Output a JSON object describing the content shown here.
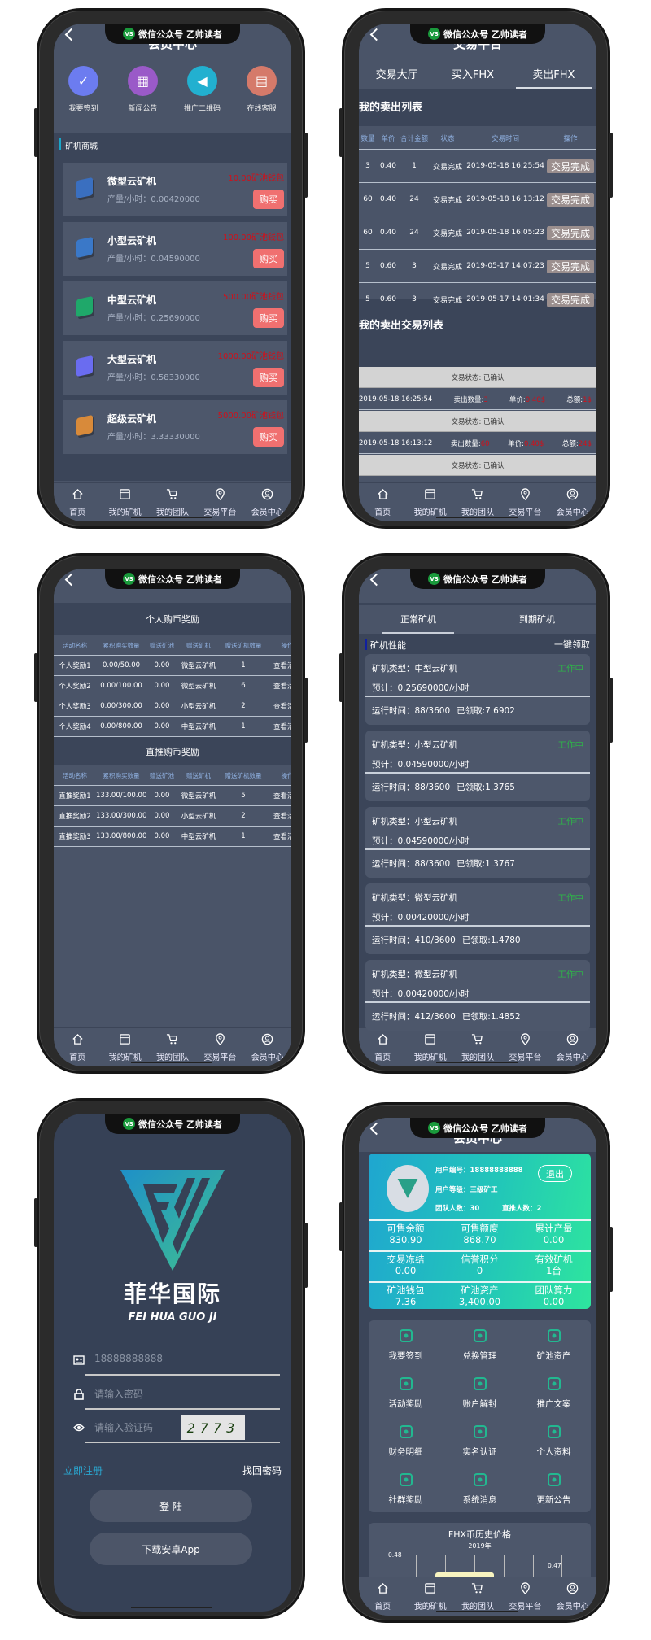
{
  "watermark": {
    "logo": "VS",
    "text": "微信公众号  乙帅读者"
  },
  "nav": [
    {
      "label": "首页",
      "icon": "home-icon"
    },
    {
      "label": "我的矿机",
      "icon": "store-icon"
    },
    {
      "label": "我的团队",
      "icon": "cart-icon"
    },
    {
      "label": "交易平台",
      "icon": "location-pin-icon"
    },
    {
      "label": "会员中心",
      "icon": "user-circle-icon"
    }
  ],
  "phone1": {
    "title": "会员中心",
    "quick": [
      {
        "label": "我要签到",
        "icon": "calendar-check-icon",
        "color": "#6c7cf0"
      },
      {
        "label": "新闻公告",
        "icon": "qr-code-icon",
        "color": "#9a5ac8"
      },
      {
        "label": "推广二维码",
        "icon": "speaker-icon",
        "color": "#22b0d0"
      },
      {
        "label": "在线客服",
        "icon": "document-icon",
        "color": "#d57a6a"
      }
    ],
    "section": "矿机商城",
    "buy_label": "购买",
    "rate_label": "产量/小时：",
    "products": [
      {
        "name": "微型云矿机",
        "rate": "0.00420000",
        "price": "10.00矿池钱包",
        "color": "#3a6fc0"
      },
      {
        "name": "小型云矿机",
        "rate": "0.04590000",
        "price": "100.00矿池钱包",
        "color": "#3a78c8"
      },
      {
        "name": "中型云矿机",
        "rate": "0.25690000",
        "price": "500.00矿池钱包",
        "color": "#1fa86a"
      },
      {
        "name": "大型云矿机",
        "rate": "0.58330000",
        "price": "1000.00矿池钱包",
        "color": "#6a6cf0"
      },
      {
        "name": "超级云矿机",
        "rate": "3.33330000",
        "price": "5000.00矿池钱包",
        "color": "#d88a3a"
      }
    ]
  },
  "phone2": {
    "title": "交易平台",
    "tabs": [
      "交易大厅",
      "买入FHX",
      "卖出FHX"
    ],
    "active_tab": 2,
    "sell_list_title": "我的卖出列表",
    "columns": [
      "数量",
      "单价",
      "合计金额",
      "状态",
      "交易时间",
      "操作"
    ],
    "rows": [
      [
        "3",
        "0.40",
        "1",
        "交易完成",
        "2019-05-18 16:25:54",
        "交易完成"
      ],
      [
        "60",
        "0.40",
        "24",
        "交易完成",
        "2019-05-18 16:13:12",
        "交易完成"
      ],
      [
        "60",
        "0.40",
        "24",
        "交易完成",
        "2019-05-18 16:05:23",
        "交易完成"
      ],
      [
        "5",
        "0.60",
        "3",
        "交易完成",
        "2019-05-17 14:07:23",
        "交易完成"
      ],
      [
        "5",
        "0.60",
        "3",
        "交易完成",
        "2019-05-17 14:01:34",
        "交易完成"
      ]
    ],
    "trade_list_title": "我的卖出交易列表",
    "qty_label": "卖出数量:",
    "price_label": "单价:",
    "total_label": "总额:",
    "trades": [
      {
        "status": "交易状态: 已确认",
        "time": "2019-05-18 16:25:54",
        "qty": "3",
        "price": "0.40$",
        "total": "1$"
      },
      {
        "status": "交易状态: 已确认",
        "time": "2019-05-18 16:13:12",
        "qty": "60",
        "price": "0.40$",
        "total": "24$"
      },
      {
        "status": "交易状态: 已确认"
      }
    ]
  },
  "phone3": {
    "sections": [
      {
        "title": "个人购币奖励",
        "columns": [
          "活动名称",
          "累积购买数量",
          "赠送矿池",
          "赠送矿机",
          "赠送矿机数量",
          "操作"
        ],
        "rows": [
          [
            "个人奖励1",
            "0.00/50.00",
            "0.00",
            "微型云矿机",
            "1",
            "查看活动"
          ],
          [
            "个人奖励2",
            "0.00/100.00",
            "0.00",
            "微型云矿机",
            "6",
            "查看活动"
          ],
          [
            "个人奖励3",
            "0.00/300.00",
            "0.00",
            "小型云矿机",
            "2",
            "查看活动"
          ],
          [
            "个人奖励4",
            "0.00/800.00",
            "0.00",
            "中型云矿机",
            "1",
            "查看活动"
          ]
        ]
      },
      {
        "title": "直推购币奖励",
        "columns": [
          "活动名称",
          "累积购买数量",
          "赠送矿池",
          "赠送矿机",
          "赠送矿机数量",
          "操作"
        ],
        "rows": [
          [
            "直推奖励1",
            "133.00/100.00",
            "0.00",
            "微型云矿机",
            "5",
            "查看活动"
          ],
          [
            "直推奖励2",
            "133.00/300.00",
            "0.00",
            "小型云矿机",
            "2",
            "查看活动"
          ],
          [
            "直推奖励3",
            "133.00/800.00",
            "0.00",
            "中型云矿机",
            "1",
            "查看活动"
          ]
        ]
      }
    ]
  },
  "phone4": {
    "tabs": [
      "正常矿机",
      "到期矿机"
    ],
    "active_tab": 0,
    "section": "矿机性能",
    "claim_all": "一键领取",
    "machines": [
      {
        "type": "矿机类型：中型云矿机",
        "status": "工作中",
        "estimate": "预计：0.25690000/小时",
        "runtime": "运行时间：88/3600",
        "claimed": "已领取:7.6902"
      },
      {
        "type": "矿机类型：小型云矿机",
        "status": "工作中",
        "estimate": "预计：0.04590000/小时",
        "runtime": "运行时间：88/3600",
        "claimed": "已领取:1.3765"
      },
      {
        "type": "矿机类型：小型云矿机",
        "status": "工作中",
        "estimate": "预计：0.04590000/小时",
        "runtime": "运行时间：88/3600",
        "claimed": "已领取:1.3767"
      },
      {
        "type": "矿机类型：微型云矿机",
        "status": "工作中",
        "estimate": "预计：0.00420000/小时",
        "runtime": "运行时间：410/3600",
        "claimed": "已领取:1.4780"
      },
      {
        "type": "矿机类型：微型云矿机",
        "status": "工作中",
        "estimate": "预计：0.00420000/小时",
        "runtime": "运行时间：412/3600",
        "claimed": "已领取:1.4852"
      }
    ]
  },
  "phone5": {
    "logo_cn": "菲华国际",
    "logo_en": "FEI HUA GUO JI",
    "phone_value": "18888888888",
    "password_placeholder": "请输入密码",
    "captcha_placeholder": "请输入验证码",
    "captcha_image": "2773",
    "register": "立即注册",
    "forgot": "找回密码",
    "login": "登 陆",
    "download": "下载安卓App"
  },
  "phone6": {
    "title": "会员中心",
    "user_id": "用户编号：18888888888",
    "level": "用户等级：三级矿工",
    "team": "团队人数：30",
    "direct": "直推人数：2",
    "logout": "退出",
    "stats": [
      {
        "label": "可售余额",
        "value": "830.90"
      },
      {
        "label": "可售额度",
        "value": "868.70"
      },
      {
        "label": "累计产量",
        "value": "0.00"
      },
      {
        "label": "交易冻结",
        "value": "0.00"
      },
      {
        "label": "信誉积分",
        "value": "0"
      },
      {
        "label": "有效矿机",
        "value": "1台"
      },
      {
        "label": "矿池钱包",
        "value": "7.36"
      },
      {
        "label": "矿池资产",
        "value": "3,400.00"
      },
      {
        "label": "团队算力",
        "value": "0.00"
      }
    ],
    "menu": [
      {
        "label": "我要签到",
        "icon": "calendar-check-icon"
      },
      {
        "label": "兑换管理",
        "icon": "exchange-icon"
      },
      {
        "label": "矿池资产",
        "icon": "coin-stack-icon"
      },
      {
        "label": "活动奖励",
        "icon": "award-icon"
      },
      {
        "label": "账户解封",
        "icon": "unlock-icon"
      },
      {
        "label": "推广文案",
        "icon": "share-icon"
      },
      {
        "label": "财务明细",
        "icon": "finance-icon"
      },
      {
        "label": "实名认证",
        "icon": "id-card-icon"
      },
      {
        "label": "个人资料",
        "icon": "user-icon"
      },
      {
        "label": "社群奖励",
        "icon": "group-icon"
      },
      {
        "label": "系统消息",
        "icon": "mail-icon"
      },
      {
        "label": "更新公告",
        "icon": "speaker-icon"
      }
    ],
    "chart_title": "FHX币历史价格",
    "chart_year": "2019年",
    "y_tick": "0.48",
    "point_label": "0.47"
  }
}
